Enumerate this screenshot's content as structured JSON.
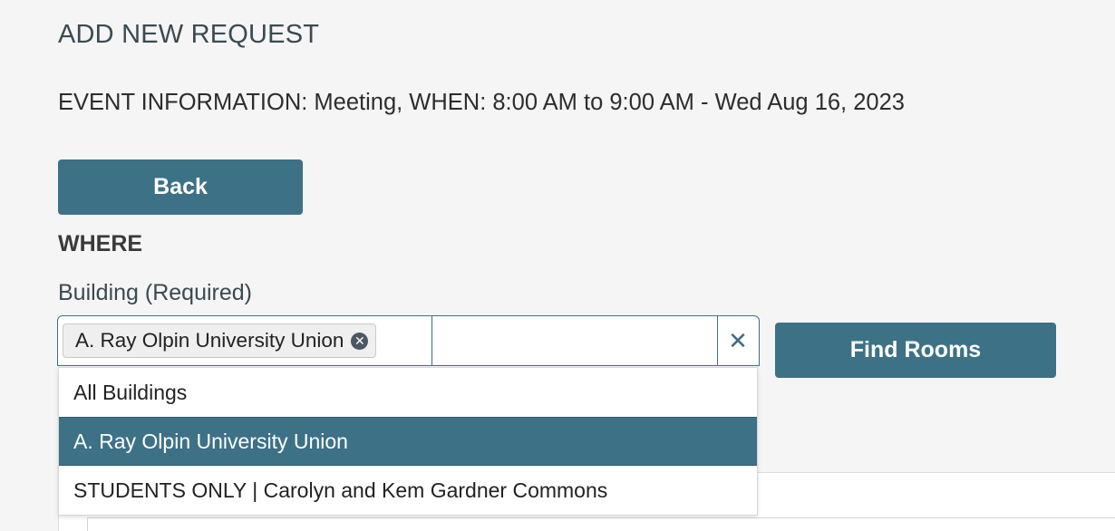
{
  "page": {
    "title": "ADD NEW REQUEST",
    "event_info": "EVENT INFORMATION: Meeting, WHEN: 8:00 AM to 9:00 AM - Wed Aug 16, 2023"
  },
  "buttons": {
    "back_label": "Back",
    "find_rooms_label": "Find Rooms"
  },
  "where": {
    "heading": "WHERE",
    "building_label": "Building (Required)",
    "selected_chip": "A. Ray Olpin University Union",
    "search_value": "",
    "search_placeholder": "",
    "clear_glyph": "✕",
    "chip_remove_glyph": "✕"
  },
  "dropdown": {
    "options": [
      {
        "label": "All Buildings",
        "selected": false
      },
      {
        "label": "A. Ray Olpin University Union",
        "selected": true
      },
      {
        "label": "STUDENTS ONLY | Carolyn and Kem Gardner Commons",
        "selected": false
      }
    ]
  },
  "icons": {
    "chip_remove": "close-circle-icon",
    "clear": "close-icon"
  },
  "colors": {
    "accent": "#3d7185",
    "background": "#f5f5f5",
    "chip_bg": "#efefef"
  }
}
